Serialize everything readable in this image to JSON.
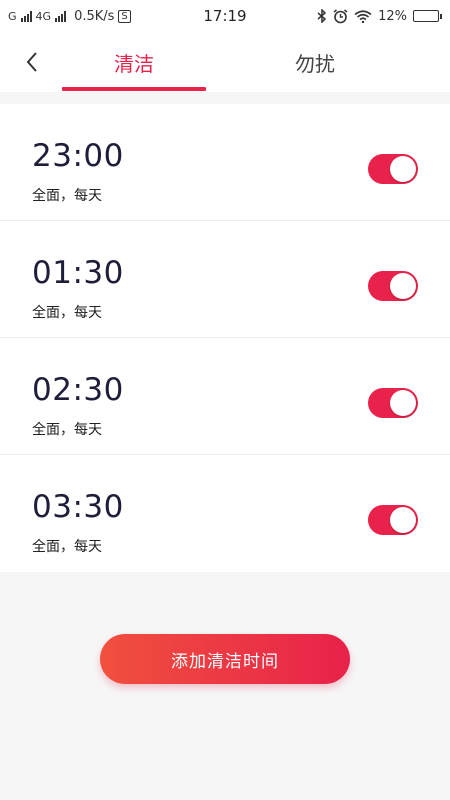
{
  "status_bar": {
    "carrier1": "G",
    "carrier2": "4G",
    "speed": "0.5K/s",
    "s_badge": "S",
    "time": "17:19",
    "battery": "12%",
    "battery_level": 0.12,
    "icons": [
      "signal-icon",
      "bluetooth-icon",
      "alarm-icon",
      "wifi-icon",
      "battery-icon"
    ]
  },
  "header": {
    "tabs": [
      {
        "label": "清洁",
        "active": true
      },
      {
        "label": "勿扰",
        "active": false
      }
    ]
  },
  "schedules": [
    {
      "time": "23:00",
      "desc": "全面，每天",
      "enabled": true
    },
    {
      "time": "01:30",
      "desc": "全面，每天",
      "enabled": true
    },
    {
      "time": "02:30",
      "desc": "全面，每天",
      "enabled": true
    },
    {
      "time": "03:30",
      "desc": "全面，每天",
      "enabled": true
    }
  ],
  "add_button": {
    "label": "添加清洁时间"
  },
  "colors": {
    "accent": "#e8224a",
    "gradient_start": "#f0503e",
    "background": "#f6f6f6"
  }
}
